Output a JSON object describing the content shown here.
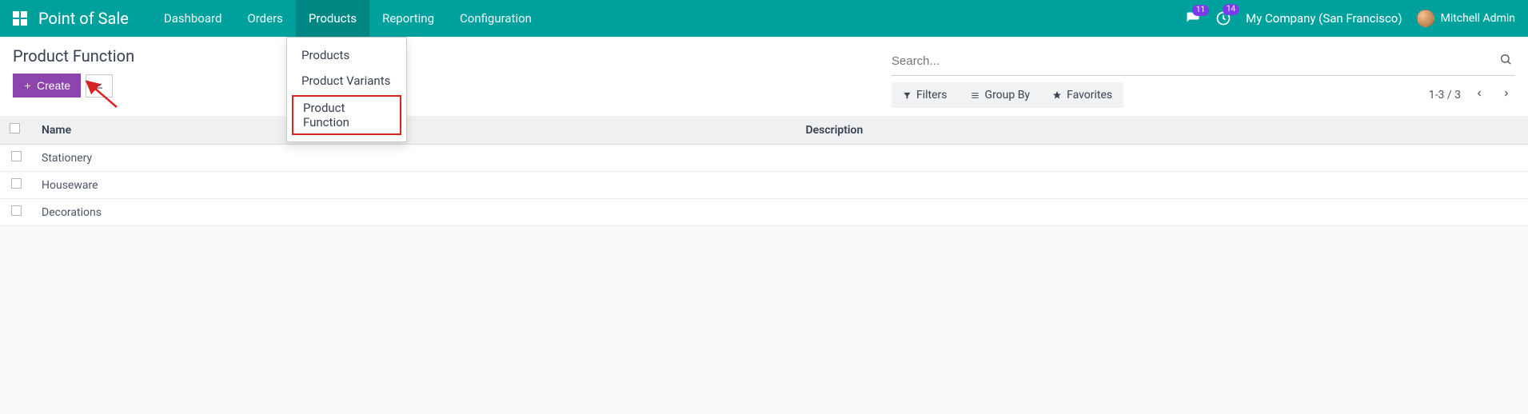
{
  "brand": "Point of Sale",
  "nav": {
    "dashboard": "Dashboard",
    "orders": "Orders",
    "products": "Products",
    "reporting": "Reporting",
    "configuration": "Configuration"
  },
  "badges": {
    "conv": "11",
    "activity": "14"
  },
  "company": "My Company (San Francisco)",
  "user": "Mitchell Admin",
  "dropdown": {
    "products": "Products",
    "variants": "Product Variants",
    "function": "Product Function"
  },
  "page_title": "Product Function",
  "buttons": {
    "create": "Create"
  },
  "search": {
    "placeholder": "Search..."
  },
  "filters": {
    "filters": "Filters",
    "groupby": "Group By",
    "favorites": "Favorites"
  },
  "pager": {
    "range": "1-3 / 3"
  },
  "table": {
    "head": {
      "name": "Name",
      "description": "Description"
    },
    "rows": [
      {
        "name": "Stationery",
        "description": ""
      },
      {
        "name": "Houseware",
        "description": ""
      },
      {
        "name": "Decorations",
        "description": ""
      }
    ]
  }
}
